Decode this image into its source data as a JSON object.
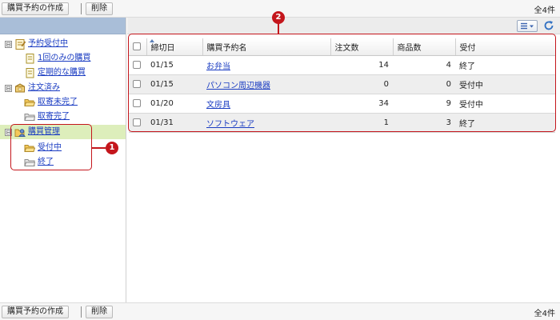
{
  "toolbar": {
    "create_label": "購買予約の作成",
    "delete_label": "削除",
    "count_label": "全4件"
  },
  "tree": [
    {
      "label": "予約受付中",
      "toggle": "⊟",
      "icon": "reservation-notebook-icon"
    },
    {
      "label": "1回のみの購買",
      "icon": "single-page-icon"
    },
    {
      "label": "定期的な購買",
      "icon": "recurring-page-icon"
    },
    {
      "label": "注文済み",
      "toggle": "⊟",
      "icon": "ordered-box-icon"
    },
    {
      "label": "取寄未完了",
      "icon": "folder-open-icon"
    },
    {
      "label": "取寄完了",
      "icon": "folder-closed-icon"
    },
    {
      "label": "購買管理",
      "toggle": "⊟",
      "icon": "purchase-admin-icon"
    },
    {
      "label": "受付中",
      "icon": "folder-open-icon"
    },
    {
      "label": "終了",
      "icon": "folder-closed-icon"
    }
  ],
  "table": {
    "columns": [
      "締切日",
      "購買予約名",
      "注文数",
      "商品数",
      "受付"
    ],
    "rows": [
      {
        "deadline": "01/15",
        "name": "お弁当",
        "orders": "14",
        "items": "4",
        "status": "終了"
      },
      {
        "deadline": "01/15",
        "name": "パソコン周辺機器",
        "orders": "0",
        "items": "0",
        "status": "受付中"
      },
      {
        "deadline": "01/20",
        "name": "文房具",
        "orders": "34",
        "items": "9",
        "status": "受付中"
      },
      {
        "deadline": "01/31",
        "name": "ソフトウェア",
        "orders": "1",
        "items": "3",
        "status": "終了"
      }
    ]
  },
  "callouts": [
    "1",
    "2"
  ],
  "colors": {
    "accent_red": "#c4161c",
    "link_blue": "#1a3cc2",
    "selected_green": "#ddeebb",
    "pane_header_blue": "#a9bed8"
  }
}
